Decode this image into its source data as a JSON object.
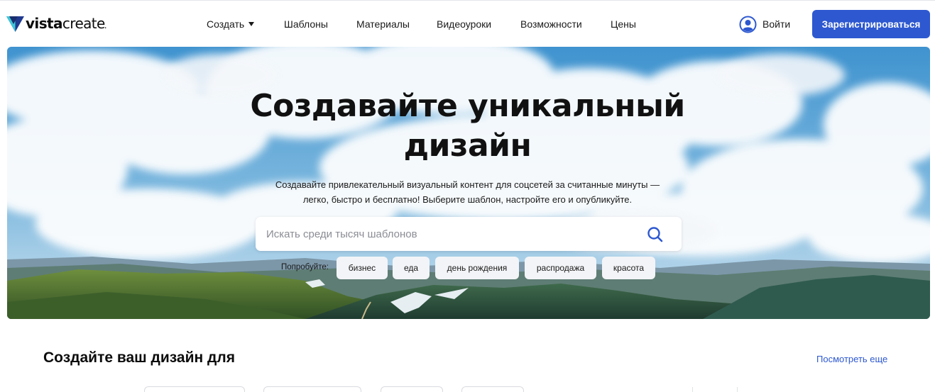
{
  "header": {
    "logo": {
      "bold": "vista",
      "regular": "create",
      "dot": "."
    },
    "nav": [
      {
        "label": "Создать",
        "dropdown": true
      },
      {
        "label": "Шаблоны"
      },
      {
        "label": "Материалы"
      },
      {
        "label": "Видеоуроки"
      },
      {
        "label": "Возможности"
      },
      {
        "label": "Цены"
      }
    ],
    "login_label": "Войти",
    "signup_label": "Зарегистрироваться"
  },
  "hero": {
    "title_line1": "Создавайте уникальный",
    "title_line2": "дизайн",
    "subtitle_line1": "Создавайте привлекательный визуальный контент для соцсетей за считанные минуты —",
    "subtitle_line2": "легко, быстро и бесплатно! Выберите шаблон, настройте его и опубликуйте.",
    "search": {
      "placeholder": "Искать среди тысяч шаблонов",
      "value": ""
    },
    "try_label": "Попробуйте:",
    "suggestions": [
      "бизнес",
      "еда",
      "день рождения",
      "распродажа",
      "красота"
    ]
  },
  "section": {
    "title": "Создайте ваш дизайн для",
    "see_more": "Посмотреть еще"
  },
  "colors": {
    "accent": "#2d58d0",
    "text": "#0c0c0c",
    "chip_bg": "#f3f4f7",
    "logo_mark": "#1f3a8f"
  },
  "icons": {
    "logo": "vistacreate-logo-icon",
    "dropdown": "caret-down-icon",
    "user": "user-circle-icon",
    "search": "search-icon"
  }
}
